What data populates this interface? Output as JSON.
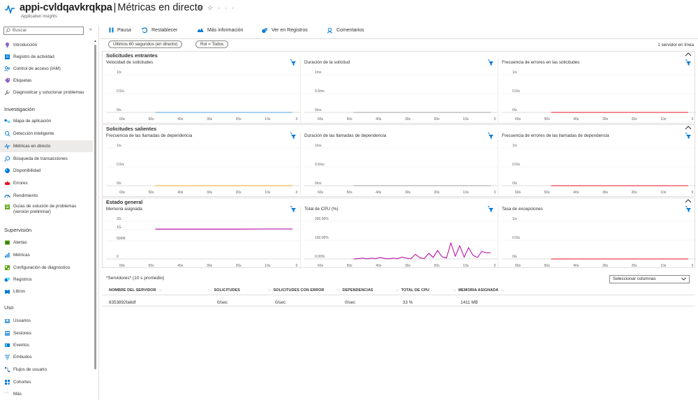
{
  "header": {
    "app_name": "appi-cvldqavkrqkpa",
    "separator": "|",
    "page_title": "Métricas en directo",
    "subtitle": "Application Insights",
    "pin_icon": "pin-icon",
    "star_icon": "star-icon",
    "more_icon": "more-icon",
    "pin_glyph": "☆",
    "star_glyph": "☆",
    "more_glyph": "···"
  },
  "sidebar": {
    "search_placeholder": "Buscar",
    "collapse_label": "«",
    "items": [
      {
        "label": "Introducción",
        "icon": "bulb-icon"
      },
      {
        "label": "Registro de actividad",
        "icon": "log-icon"
      },
      {
        "label": "Control de acceso (IAM)",
        "icon": "people-icon"
      },
      {
        "label": "Etiquetas",
        "icon": "tag-icon"
      },
      {
        "label": "Diagnosticar y solucionar problemas",
        "icon": "wrench-icon"
      }
    ],
    "sections": [
      {
        "heading": "Investigación",
        "items": [
          {
            "label": "Mapa de aplicación",
            "icon": "app-map-icon"
          },
          {
            "label": "Detección inteligente",
            "icon": "smart-detection-icon"
          },
          {
            "label": "Métricas en directo",
            "icon": "live-metrics-icon",
            "active": true
          },
          {
            "label": "Búsqueda de transacciones",
            "icon": "search-icon"
          },
          {
            "label": "Disponibilidad",
            "icon": "globe-icon"
          },
          {
            "label": "Errores",
            "icon": "failures-icon"
          },
          {
            "label": "Rendimiento",
            "icon": "performance-icon"
          },
          {
            "label": "Guías de solución de problemas (versión preliminar)",
            "icon": "guide-icon"
          }
        ]
      },
      {
        "heading": "Supervisión",
        "items": [
          {
            "label": "Alertas",
            "icon": "alerts-icon"
          },
          {
            "label": "Métricas",
            "icon": "metrics-icon"
          },
          {
            "label": "Configuración de diagnóstico",
            "icon": "diag-settings-icon"
          },
          {
            "label": "Registros",
            "icon": "logs-icon"
          },
          {
            "label": "Libros",
            "icon": "workbooks-icon"
          }
        ]
      },
      {
        "heading": "Uso",
        "items": [
          {
            "label": "Usuarios",
            "icon": "users-icon"
          },
          {
            "label": "Sesiones",
            "icon": "sessions-icon"
          },
          {
            "label": "Eventos",
            "icon": "events-icon"
          },
          {
            "label": "Embudos",
            "icon": "funnels-icon"
          },
          {
            "label": "Flujos de usuario",
            "icon": "user-flows-icon"
          },
          {
            "label": "Cohortes",
            "icon": "cohorts-icon"
          },
          {
            "label": "Más",
            "icon": "more-icon"
          }
        ]
      }
    ]
  },
  "toolbar": {
    "pause": "Pausa",
    "reset": "Restablecer",
    "more_info": "Más información",
    "view_logs": "Ver en Registros",
    "feedback": "Comentarios"
  },
  "filters": {
    "time_range": "Últimos 60 segundos (en directo)",
    "role": "Rol = Todos",
    "servers_online": "1 servidor en línea"
  },
  "x_ticks": [
    "60s",
    "50s",
    "40s",
    "30s",
    "20s",
    "10s",
    "0"
  ],
  "sections": [
    {
      "title": "Solicitudes entrantes",
      "panels": [
        {
          "title": "Velocidad de solicitudes",
          "y_ticks": [
            "1/s",
            "0.5/s",
            "0/s"
          ],
          "color": "#4ea3e0"
        },
        {
          "title": "Duración de la solicitud",
          "y_ticks": [
            "1ms",
            "0.5ms",
            "0ms"
          ],
          "color": "#a0a0a0"
        },
        {
          "title": "Frecuencia de errores en las solicitudes",
          "y_ticks": [
            "1/s",
            "0.5/s",
            "0/s"
          ],
          "color": "#e81123"
        }
      ]
    },
    {
      "title": "Solicitudes salientes",
      "panels": [
        {
          "title": "Frecuencia de las llamadas de dependencia",
          "y_ticks": [
            "1/s",
            "0.5/s",
            "0/s"
          ],
          "color": "#f7a823"
        },
        {
          "title": "Duración de las llamadas de dependencia",
          "y_ticks": [
            "1ms",
            "0.5ms",
            "0ms"
          ],
          "color": "#a0a0a0"
        },
        {
          "title": "Frecuencia de errores de las llamadas de dependencia",
          "y_ticks": [
            "1/s",
            "0.5/s",
            "0/s"
          ],
          "color": "#e81123"
        }
      ]
    },
    {
      "title": "Estado general",
      "panels": [
        {
          "title": "Memoria asignada",
          "y_ticks": [
            "2G",
            "1G",
            "500M",
            "0"
          ],
          "color": "#b4009e"
        },
        {
          "title": "Total de CPU (%)",
          "y_ticks": [
            "200.00%",
            "100.00%",
            "0.00%"
          ],
          "color": "#b4009e"
        },
        {
          "title": "Tasa de excepciones",
          "y_ticks": [
            "1/s",
            "0.5/s",
            "0/s"
          ],
          "color": "#e81123"
        }
      ]
    }
  ],
  "series": {
    "memory_gb": [
      1.4,
      1.4,
      1.4,
      1.4,
      1.41,
      1.41
    ],
    "cpu_percent": [
      0,
      2,
      5,
      1,
      4,
      2,
      8,
      3,
      1,
      5,
      2,
      10,
      4,
      2,
      25,
      6,
      2,
      30,
      8,
      45,
      12,
      5,
      85,
      15,
      70,
      10,
      60,
      20,
      8,
      40,
      33,
      33
    ]
  },
  "servers": {
    "title": "*Servidores* (10 s promedio)",
    "select_columns": "Seleccionar columnas",
    "columns": [
      "NOMBRE DEL SERVIDOR",
      "SOLICITUDES",
      "SOLICITUDES CON ERROR",
      "DEPENDENCIAS",
      "TOTAL DE CPU",
      "MEMORIA ASIGNADA"
    ],
    "rows": [
      {
        "name": "8353892fa6df",
        "requests": "0/sec",
        "failed": "0/sec",
        "dependencies": "0/sec",
        "cpu": "33 %",
        "memory": "1411 MB"
      }
    ]
  }
}
